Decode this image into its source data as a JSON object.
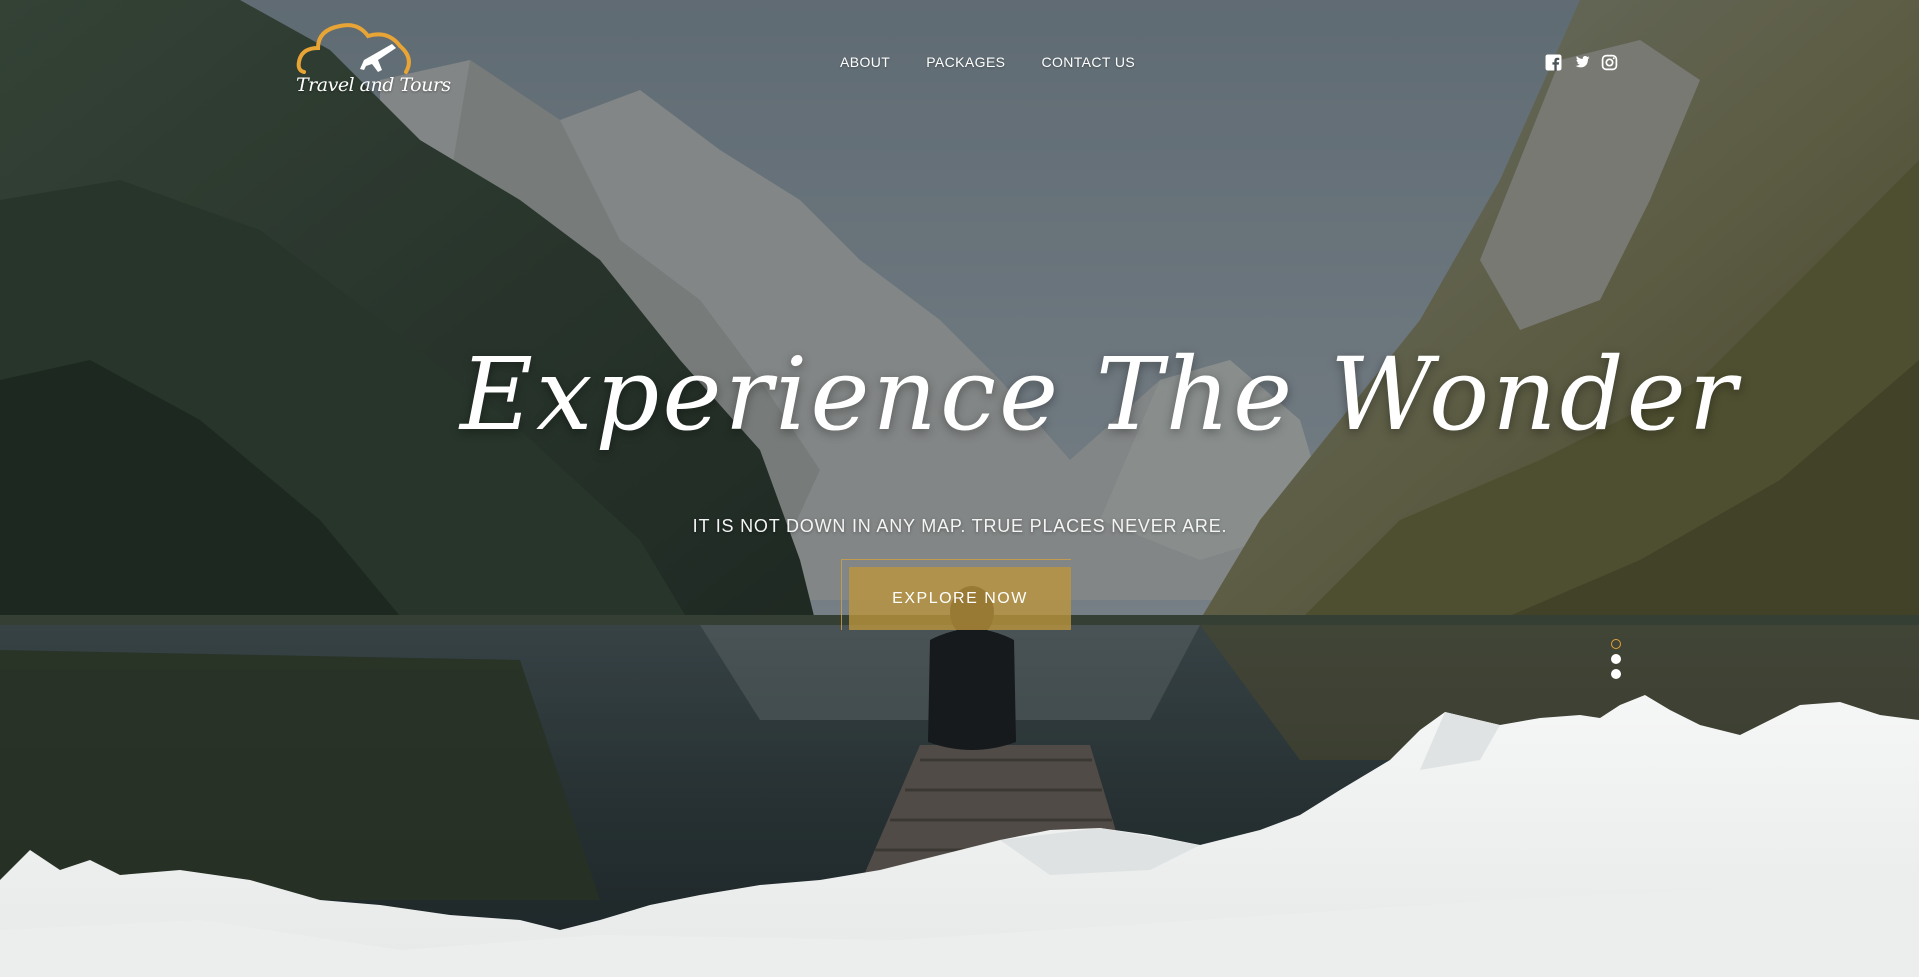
{
  "brand": {
    "logo_text": "Travel and Tours",
    "accent_color": "#e8a435",
    "logo_icons": [
      "cloud-icon",
      "airplane-icon"
    ]
  },
  "nav": {
    "items": [
      {
        "label": "ABOUT"
      },
      {
        "label": "PACKAGES"
      },
      {
        "label": "CONTACT US"
      }
    ]
  },
  "social": {
    "icons": [
      "facebook-icon",
      "twitter-icon",
      "instagram-icon"
    ]
  },
  "hero": {
    "headline": "Experience The Wonder",
    "tagline": "IT IS NOT DOWN IN ANY MAP. TRUE PLACES NEVER ARE.",
    "cta_label": "EXPLORE NOW",
    "cta_color": "#be963c",
    "background": "mountain lake photo with person sitting on wooden dock"
  },
  "slider": {
    "total": 3,
    "active": 1,
    "active_color": "#e0a33a"
  }
}
